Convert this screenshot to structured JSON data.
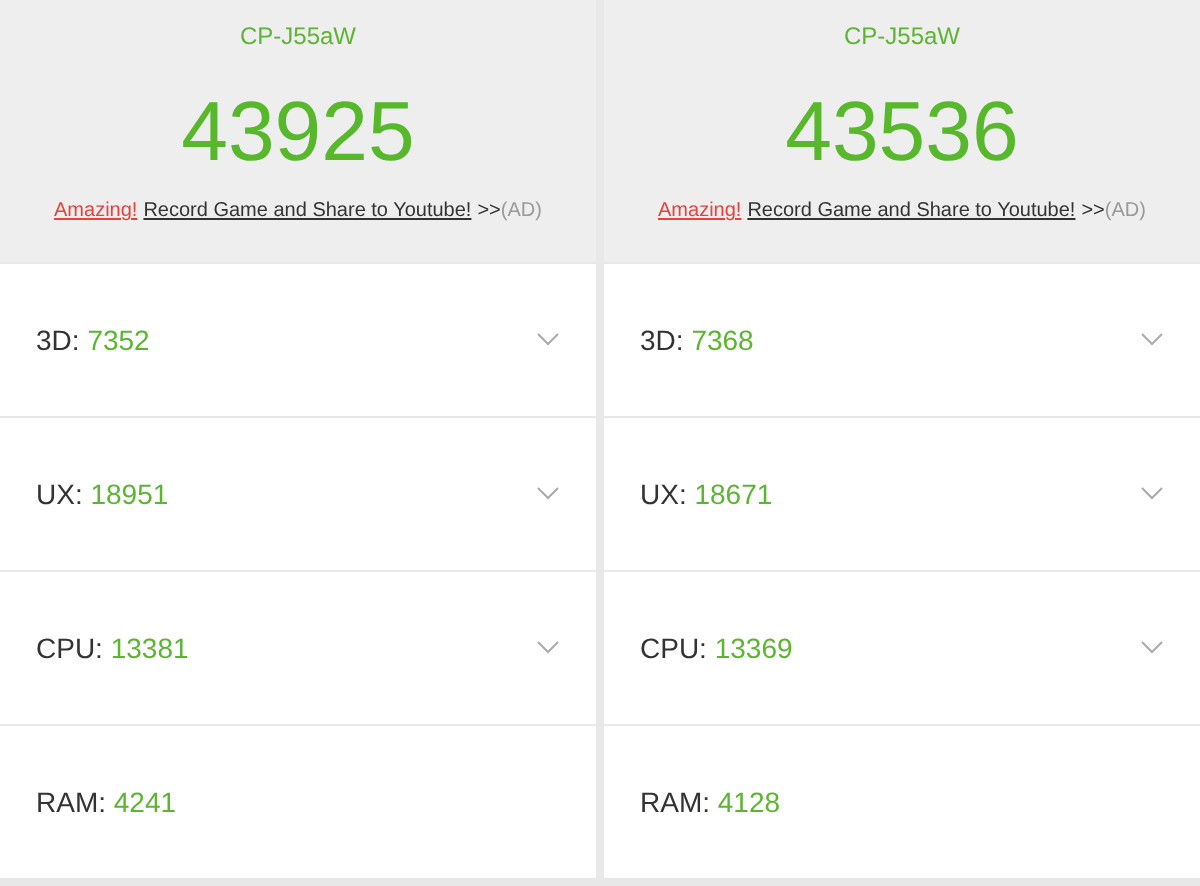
{
  "panels": [
    {
      "device": "CP-J55aW",
      "total": "43925",
      "promo": {
        "highlight": "Amazing!",
        "link": "Record Game and Share to Youtube!",
        "arrows": ">>",
        "ad": "(AD)"
      },
      "rows": [
        {
          "label": "3D:",
          "score": "7352",
          "kind": "expandable"
        },
        {
          "label": "UX:",
          "score": "18951",
          "kind": "expandable"
        },
        {
          "label": "CPU:",
          "score": "13381",
          "kind": "expandable"
        },
        {
          "label": "RAM:",
          "score": "4241",
          "kind": "plain"
        }
      ]
    },
    {
      "device": "CP-J55aW",
      "total": "43536",
      "promo": {
        "highlight": "Amazing!",
        "link": "Record Game and Share to Youtube!",
        "arrows": ">>",
        "ad": "(AD)"
      },
      "rows": [
        {
          "label": "3D:",
          "score": "7368",
          "kind": "expandable"
        },
        {
          "label": "UX:",
          "score": "18671",
          "kind": "expandable"
        },
        {
          "label": "CPU:",
          "score": "13369",
          "kind": "expandable"
        },
        {
          "label": "RAM:",
          "score": "4128",
          "kind": "plain"
        }
      ]
    }
  ]
}
